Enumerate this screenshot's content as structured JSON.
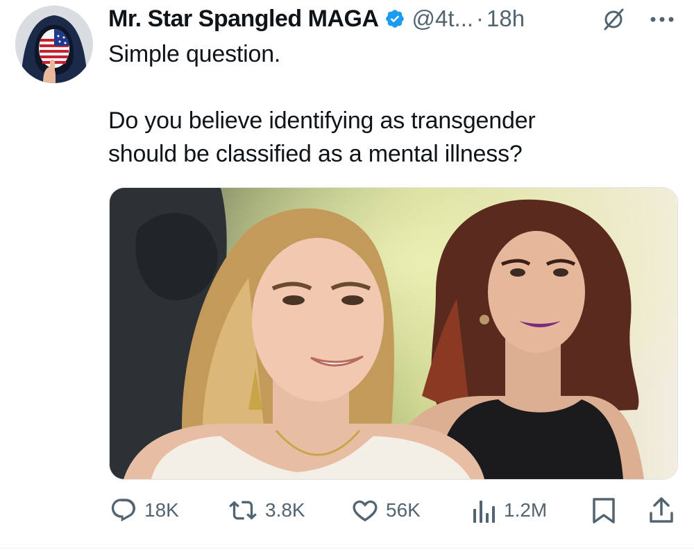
{
  "author": {
    "display_name": "Mr. Star Spangled MAGA",
    "handle": "@4t...",
    "time": "18h",
    "verified_color": "#1d9bf0"
  },
  "tweet": {
    "line1": "Simple question.",
    "line2": "Do you believe identifying as transgender",
    "line3": "should be classified as a mental illness?"
  },
  "actions": {
    "replies": "18K",
    "reposts": "3.8K",
    "likes": "56K",
    "views": "1.2M"
  },
  "icons": {
    "reply": "reply-bubble-icon",
    "repost": "repost-arrows-icon",
    "like": "heart-icon",
    "views": "bar-chart-icon",
    "bookmark": "bookmark-icon",
    "share": "share-upload-icon",
    "grok": "grok-slash-circle-icon",
    "more": "more-dots-icon"
  },
  "colors": {
    "text": "#0f1419",
    "secondary": "#536471",
    "accent": "#1d9bf0"
  }
}
